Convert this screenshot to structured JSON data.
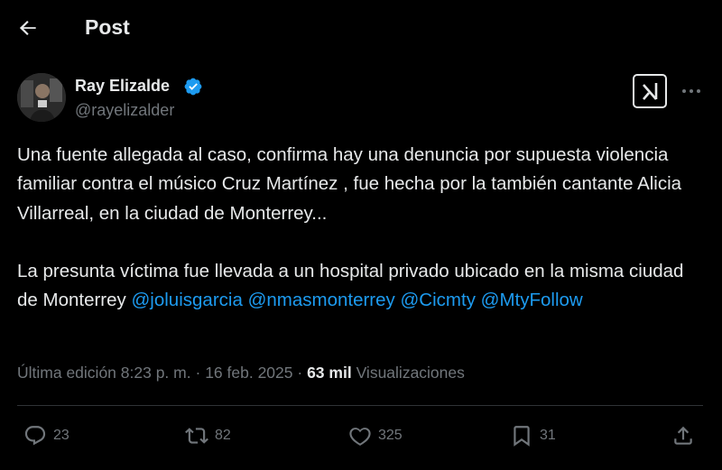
{
  "header": {
    "title": "Post"
  },
  "author": {
    "name": "Ray Elizalde",
    "handle": "@rayelizalder",
    "verified_color": "#1d9bf0"
  },
  "post": {
    "paragraph1": "Una fuente allegada al caso, confirma hay una denuncia por supuesta violencia familiar contra el músico Cruz Martínez , fue hecha por la también cantante Alicia Villarreal, en la ciudad de Monterrey...",
    "paragraph2_text": "La presunta víctima fue llevada a un hospital privado ubicado en la misma ciudad de Monterrey",
    "mentions": [
      "@joluisgarcia",
      "@nmasmonterrey",
      "@Cicmty",
      "@MtyFollow"
    ]
  },
  "meta": {
    "edited_label": "Última edición",
    "time": "8:23 p. m.",
    "separator": "·",
    "date": "16 feb. 2025",
    "views_count": "63 mil",
    "views_label": "Visualizaciones"
  },
  "actions": {
    "replies": "23",
    "reposts": "82",
    "likes": "325",
    "bookmarks": "31"
  },
  "colors": {
    "background": "#000000",
    "text": "#e7e9ea",
    "secondary": "#71767b",
    "link": "#1d9bf0",
    "divider": "#2f3336"
  }
}
